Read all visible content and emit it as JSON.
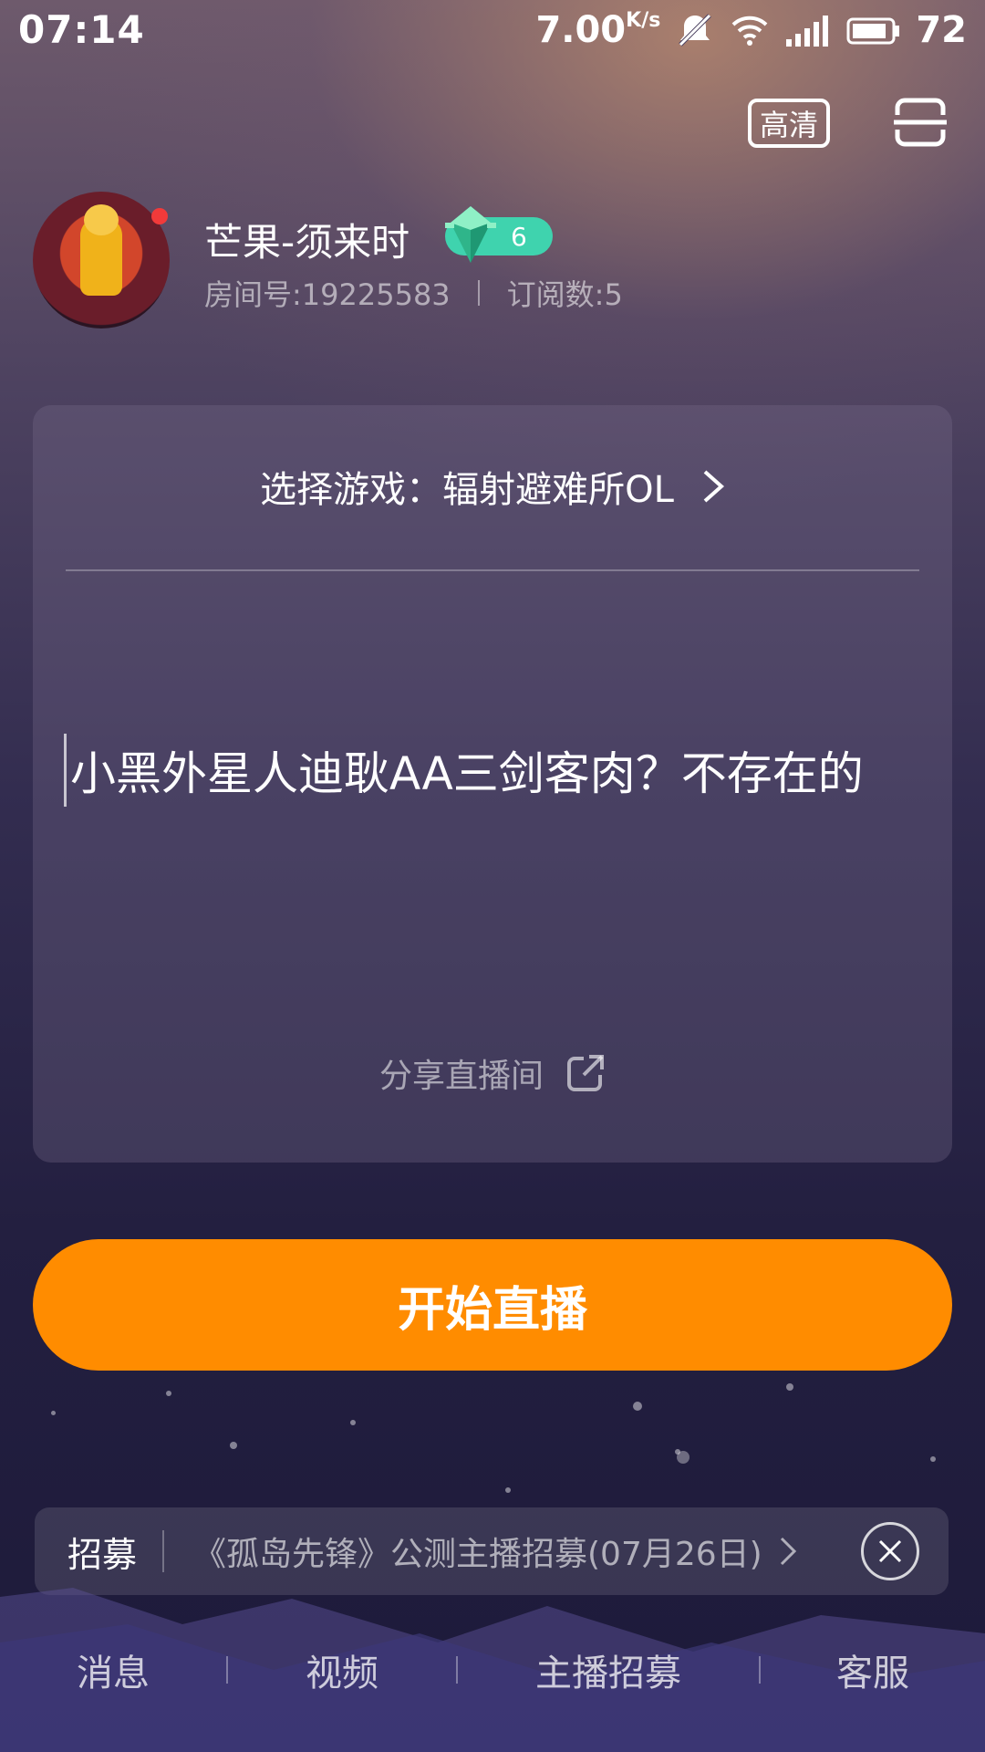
{
  "status_bar": {
    "time": "07:14",
    "speed": "7.00",
    "speed_unit": "K/s",
    "battery": "72",
    "icons": [
      "mute-icon",
      "wifi-icon",
      "signal-4g-icon",
      "battery-icon"
    ]
  },
  "header": {
    "quality_label": "高清",
    "scan_icon": "scan-icon"
  },
  "profile": {
    "nickname": "芒果-须来时",
    "level": "6",
    "room_number": "房间号:19225583",
    "subscribers": "订阅数:5"
  },
  "card": {
    "game_select": "选择游戏：辐射避难所OL",
    "title_value": "小黑外星人迪耿AA三剑客肉？不存在的",
    "share_label": "分享直播间"
  },
  "start_button": {
    "label": "开始直播"
  },
  "recruit": {
    "tag": "招募",
    "text": "《孤岛先锋》公测主播招募(07月26日)"
  },
  "bottom_nav": {
    "items": [
      "消息",
      "视频",
      "主播招募",
      "客服"
    ]
  },
  "colors": {
    "accent": "#ff8c00",
    "level_badge": "#3fd3ae",
    "live_dot": "#f23a3a"
  }
}
